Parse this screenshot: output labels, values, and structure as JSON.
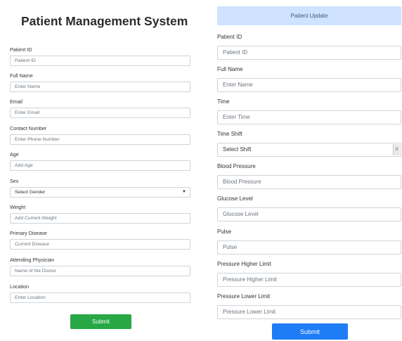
{
  "left": {
    "title": "Patient Management System",
    "fields": [
      {
        "label": "Patient ID",
        "placeholder": "Patient ID"
      },
      {
        "label": "Full Name",
        "placeholder": "Enter Name"
      },
      {
        "label": "Email",
        "placeholder": "Enter Email"
      },
      {
        "label": "Contact Number",
        "placeholder": "Enter Phone Number"
      },
      {
        "label": "Age",
        "placeholder": "Add Age"
      },
      {
        "label": "Sex",
        "placeholder": "Select Gender"
      },
      {
        "label": "Weight",
        "placeholder": "Add Current Weight"
      },
      {
        "label": "Primary Disease",
        "placeholder": "Current Disease"
      },
      {
        "label": "Attending Physician",
        "placeholder": "Name of the Doctor"
      },
      {
        "label": "Location",
        "placeholder": "Enter Location"
      }
    ],
    "submit_label": "Submit",
    "submit_color": "#28a745"
  },
  "right": {
    "header": "Patient Update",
    "header_color": "#cfe2ff",
    "fields": [
      {
        "label": "Patient ID",
        "placeholder": "Patient ID"
      },
      {
        "label": "Full Name",
        "placeholder": "Enter Name"
      },
      {
        "label": "Time",
        "placeholder": "Enter Time"
      },
      {
        "label": "Time Shift",
        "placeholder": "Select Shift"
      },
      {
        "label": "Blood Pressure",
        "placeholder": "Blood Pressure"
      },
      {
        "label": "Glucose Level",
        "placeholder": "Glucose Level"
      },
      {
        "label": "Pulse",
        "placeholder": "Pulse"
      },
      {
        "label": "Pressure Higher Limit",
        "placeholder": "Pressure Higher Limit"
      },
      {
        "label": "Pressure Lower Limit",
        "placeholder": "Pressure Lower Limit"
      }
    ],
    "submit_label": "Submit",
    "submit_color": "#1e7cf7"
  }
}
